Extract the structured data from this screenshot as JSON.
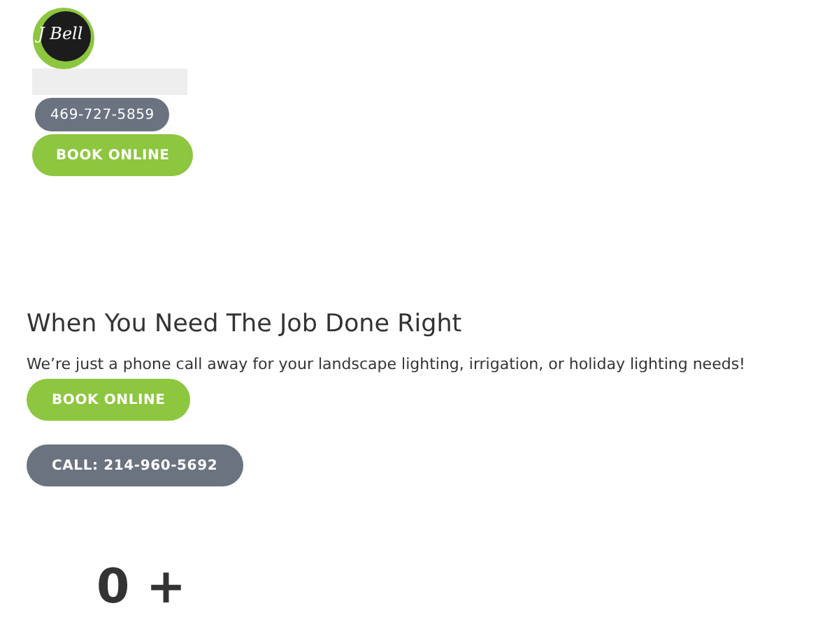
{
  "header": {
    "logo_text": "J Bell",
    "phone_button": "469-727-5859",
    "book_button": "BOOK ONLINE"
  },
  "hero": {
    "heading": "When You Need The Job Done Right",
    "text": "We’re just a phone call away for your landscape lighting, irrigation, or holiday lighting needs!",
    "book_button": "BOOK ONLINE",
    "call_button": "CALL: 214-960-5692"
  },
  "stat": {
    "value": "0 +"
  }
}
